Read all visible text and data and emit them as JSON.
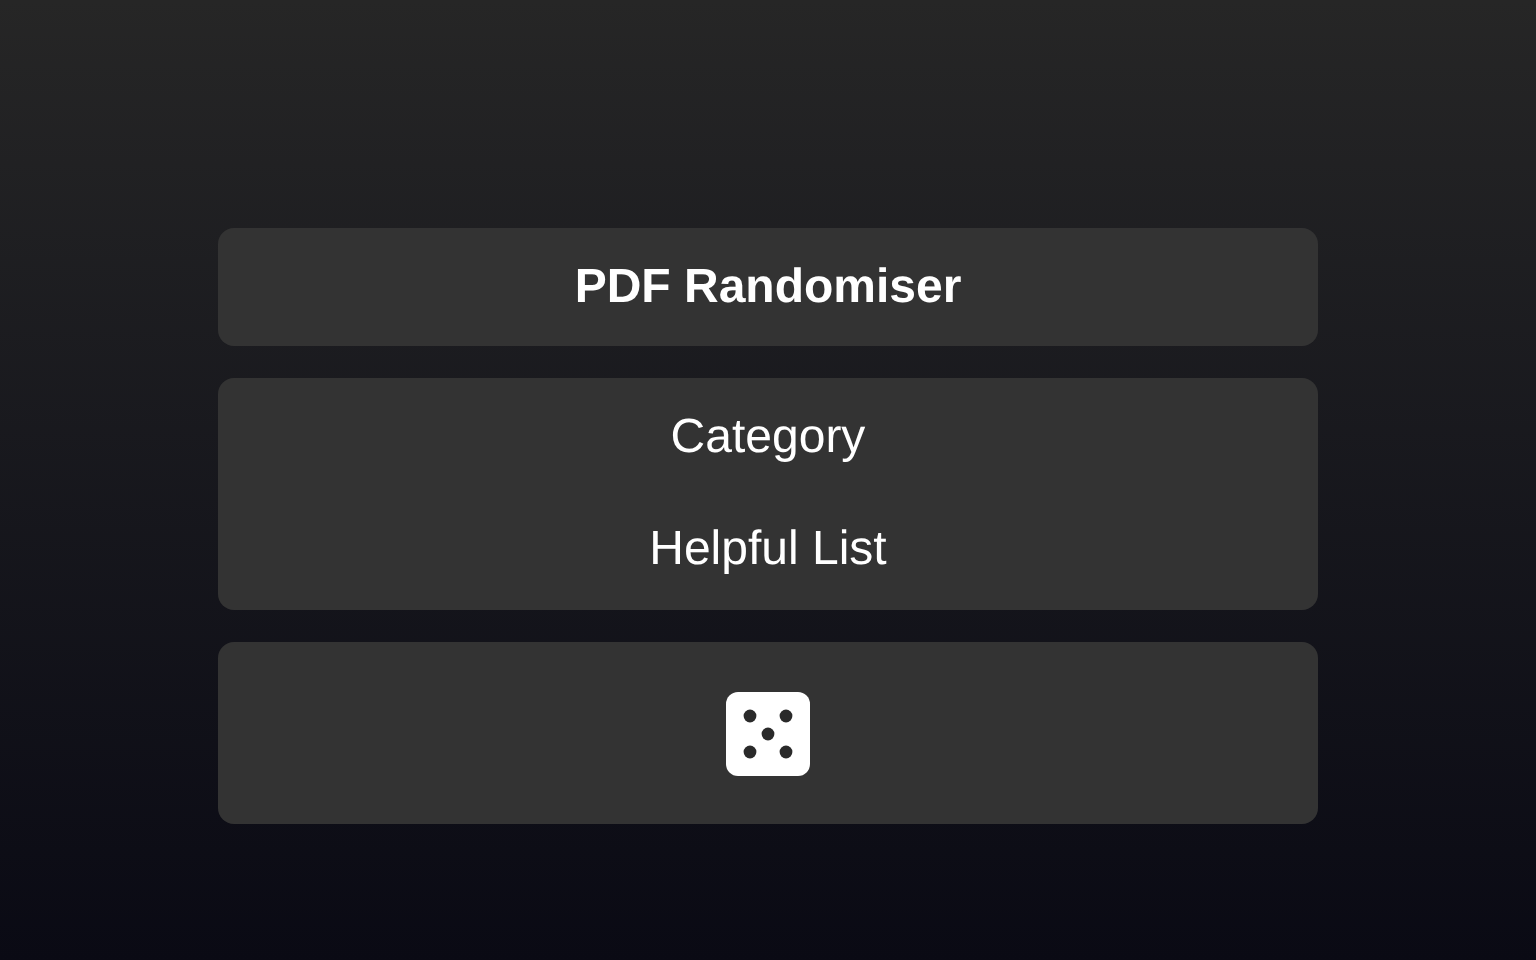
{
  "header": {
    "title": "PDF Randomiser"
  },
  "menu": [
    {
      "label": "Category"
    },
    {
      "label": "Helpful List"
    }
  ]
}
